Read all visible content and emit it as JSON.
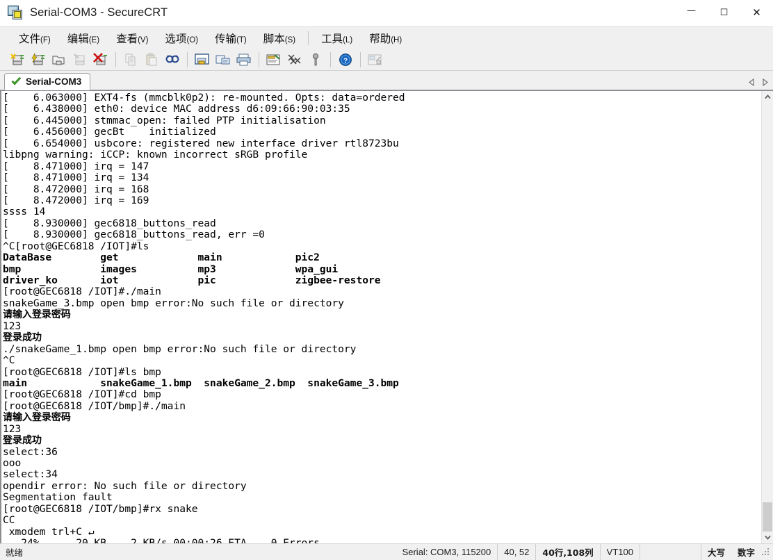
{
  "window": {
    "title": "Serial-COM3 - SecureCRT",
    "icon": "securecrt-app-icon",
    "minimize": "minimize-icon",
    "maximize": "maximize-icon",
    "close": "close-icon"
  },
  "menubar": {
    "items": [
      {
        "label": "文件",
        "mnemonic": "(F)"
      },
      {
        "label": "编辑",
        "mnemonic": "(E)"
      },
      {
        "label": "查看",
        "mnemonic": "(V)"
      },
      {
        "label": "选项",
        "mnemonic": "(O)"
      },
      {
        "label": "传输",
        "mnemonic": "(T)"
      },
      {
        "label": "脚本",
        "mnemonic": "(S)"
      },
      {
        "label": "工具",
        "mnemonic": "(L)"
      },
      {
        "label": "帮助",
        "mnemonic": "(H)"
      }
    ]
  },
  "toolbar": {
    "buttons": [
      {
        "name": "new-session-icon",
        "enabled": true
      },
      {
        "name": "quick-connect-icon",
        "enabled": true
      },
      {
        "name": "connect-in-tab-icon",
        "enabled": true
      },
      {
        "name": "reconnect-icon",
        "enabled": false
      },
      {
        "name": "disconnect-icon",
        "enabled": true
      },
      {
        "name": "copy-icon",
        "enabled": false
      },
      {
        "name": "paste-icon",
        "enabled": false
      },
      {
        "name": "find-icon",
        "enabled": true
      },
      {
        "name": "print-screen-icon",
        "enabled": true
      },
      {
        "name": "log-session-icon",
        "enabled": true
      },
      {
        "name": "print-icon",
        "enabled": true
      },
      {
        "name": "session-options-icon",
        "enabled": true
      },
      {
        "name": "global-options-icon",
        "enabled": true
      },
      {
        "name": "key-icon",
        "enabled": true
      },
      {
        "name": "help-icon",
        "enabled": true
      },
      {
        "name": "arrange-icon",
        "enabled": false
      }
    ]
  },
  "tabs": {
    "active": "Serial-COM3",
    "status_icon": "green-check-icon",
    "scroll_left": "chevron-left-icon",
    "scroll_right": "chevron-right-icon"
  },
  "terminal": {
    "lines": [
      {
        "text": "[    6.063000] EXT4-fs (mmcblk0p2): re-mounted. Opts: data=ordered",
        "bold": false,
        "cjk": false
      },
      {
        "text": "[    6.438000] eth0: device MAC address d6:09:66:90:03:35",
        "bold": false,
        "cjk": false
      },
      {
        "text": "[    6.445000] stmmac_open: failed PTP initialisation",
        "bold": false,
        "cjk": false
      },
      {
        "text": "[    6.456000] gecBt    initialized",
        "bold": false,
        "cjk": false
      },
      {
        "text": "[    6.654000] usbcore: registered new interface driver rtl8723bu",
        "bold": false,
        "cjk": false
      },
      {
        "text": "libpng warning: iCCP: known incorrect sRGB profile",
        "bold": false,
        "cjk": false
      },
      {
        "text": "[    8.471000] irq = 147",
        "bold": false,
        "cjk": false
      },
      {
        "text": "[    8.471000] irq = 134",
        "bold": false,
        "cjk": false
      },
      {
        "text": "[    8.472000] irq = 168",
        "bold": false,
        "cjk": false
      },
      {
        "text": "[    8.472000] irq = 169",
        "bold": false,
        "cjk": false
      },
      {
        "text": "ssss 14",
        "bold": false,
        "cjk": false
      },
      {
        "text": "[    8.930000] gec6818_buttons_read",
        "bold": false,
        "cjk": false
      },
      {
        "text": "[    8.930000] gec6818_buttons_read, err =0",
        "bold": false,
        "cjk": false
      },
      {
        "text": "^C[root@GEC6818 /IOT]#ls",
        "bold": false,
        "cjk": false
      },
      {
        "text": "DataBase        get             main            pic2",
        "bold": true,
        "cjk": false
      },
      {
        "text": "bmp             images          mp3             wpa_gui",
        "bold": true,
        "cjk": false
      },
      {
        "text": "driver_ko       iot             pic             zigbee-restore",
        "bold": true,
        "cjk": false
      },
      {
        "text": "[root@GEC6818 /IOT]#./main",
        "bold": false,
        "cjk": false
      },
      {
        "text": "snakeGame_3.bmp open bmp error:No such file or directory",
        "bold": false,
        "cjk": false
      },
      {
        "text": "请输入登录密码",
        "bold": false,
        "cjk": true
      },
      {
        "text": "123",
        "bold": false,
        "cjk": false
      },
      {
        "text": "登录成功",
        "bold": false,
        "cjk": true
      },
      {
        "text": "./snakeGame_1.bmp open bmp error:No such file or directory",
        "bold": false,
        "cjk": false
      },
      {
        "text": "^C",
        "bold": false,
        "cjk": false
      },
      {
        "text": "[root@GEC6818 /IOT]#ls bmp",
        "bold": false,
        "cjk": false
      },
      {
        "text": "main            snakeGame_1.bmp  snakeGame_2.bmp  snakeGame_3.bmp",
        "bold": true,
        "cjk": false
      },
      {
        "text": "[root@GEC6818 /IOT]#cd bmp",
        "bold": false,
        "cjk": false
      },
      {
        "text": "[root@GEC6818 /IOT/bmp]#./main",
        "bold": false,
        "cjk": false
      },
      {
        "text": "请输入登录密码",
        "bold": false,
        "cjk": true
      },
      {
        "text": "123",
        "bold": false,
        "cjk": false
      },
      {
        "text": "登录成功",
        "bold": false,
        "cjk": true
      },
      {
        "text": "select:36",
        "bold": false,
        "cjk": false
      },
      {
        "text": "ooo",
        "bold": false,
        "cjk": false
      },
      {
        "text": "select:34",
        "bold": false,
        "cjk": false
      },
      {
        "text": "opendir error: No such file or directory",
        "bold": false,
        "cjk": false
      },
      {
        "text": "Segmentation fault",
        "bold": false,
        "cjk": false
      },
      {
        "text": "[root@GEC6818 /IOT/bmp]#rx snake",
        "bold": false,
        "cjk": false
      },
      {
        "text": "CC",
        "bold": false,
        "cjk": false
      },
      {
        "text": " xmodem trl+C ↵",
        "bold": false,
        "cjk": false
      },
      {
        "text": "   24%      20 KB    2 KB/s 00:00:26 ETA    0 Errors",
        "bold": false,
        "cjk": false
      }
    ],
    "scrollbar": {
      "up": "scroll-up-icon",
      "down": "scroll-down-icon",
      "position": "bottom"
    }
  },
  "statusbar": {
    "ready": "就绪",
    "connection": "Serial: COM3, 115200",
    "cursor": "40, 52",
    "size": "40行,108列",
    "emulation": "VT100",
    "caps": "大写",
    "num": "数字"
  }
}
